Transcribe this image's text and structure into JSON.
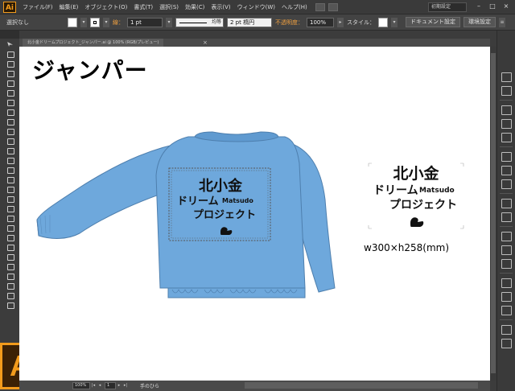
{
  "app": {
    "logo_text": "Ai",
    "big_logo_text": "Ai"
  },
  "menubar": {
    "items": [
      {
        "label": "ファイル(F)"
      },
      {
        "label": "編集(E)"
      },
      {
        "label": "オブジェクト(O)"
      },
      {
        "label": "書式(T)"
      },
      {
        "label": "選択(S)"
      },
      {
        "label": "効果(C)"
      },
      {
        "label": "表示(V)"
      },
      {
        "label": "ウィンドウ(W)"
      },
      {
        "label": "ヘルプ(H)"
      }
    ],
    "workspace": "初期設定",
    "window_buttons": [
      "–",
      "□",
      "×"
    ]
  },
  "controlbar": {
    "selection_label": "選択なし",
    "stroke_label": "線：",
    "stroke_weight": "1 pt",
    "stroke_profile": "均等",
    "brush": "2 pt 楕円",
    "opacity_label": "不透明度：",
    "opacity_value": "100%",
    "style_label": "スタイル：",
    "doc_settings_button": "ドキュメント設定",
    "prefs_button": "環境設定"
  },
  "document": {
    "tab_label": "北小金ドリームプロジェクト_ジャンパー.ai @ 100% (RGB/プレビュー)",
    "tab_close": "×"
  },
  "canvas": {
    "title": "ジャンパー",
    "logo_line1": "北小金",
    "logo_line2": "ドリーム",
    "logo_line2_latin": "Matsudo",
    "logo_line3": "プロジェクト",
    "size_caption": "w300×h258(mm)"
  },
  "statusbar": {
    "zoom": "100%",
    "page": "1",
    "status_text": "手のひら"
  },
  "colors": {
    "jacket_fill": "#6ea8dc",
    "jacket_stroke": "#4e7fae",
    "ui_dark": "#3c3c3c",
    "brand_orange": "#f29b1c"
  }
}
